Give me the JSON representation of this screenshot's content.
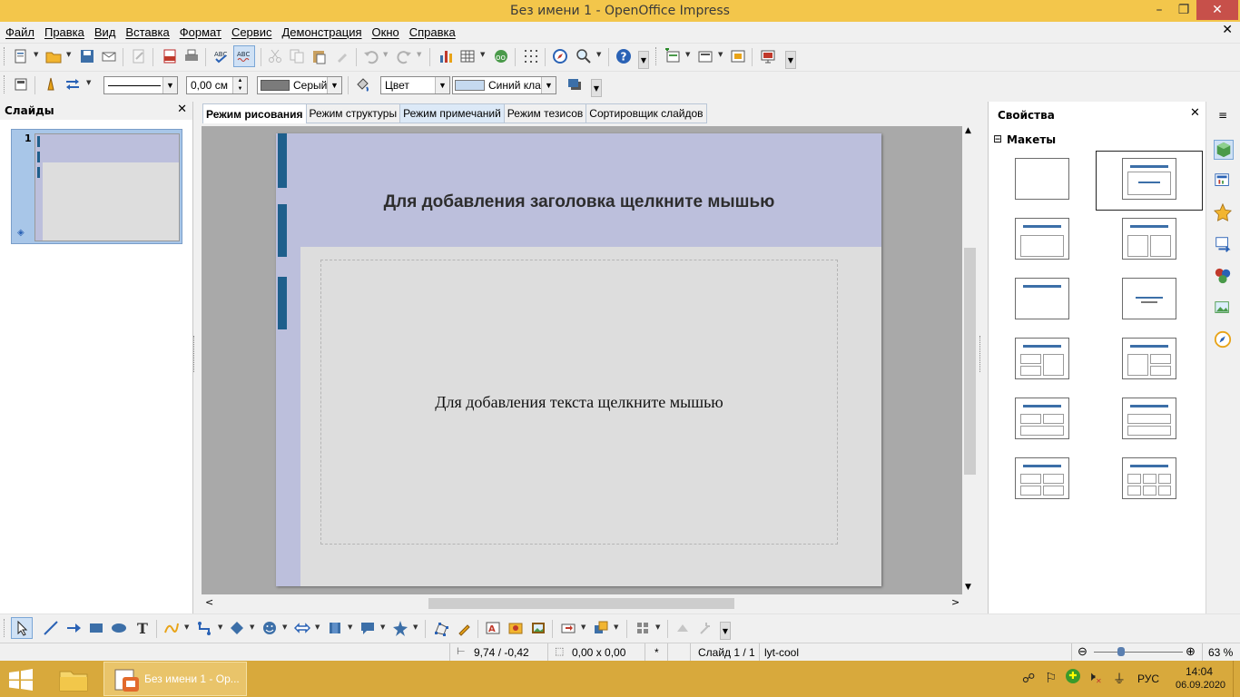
{
  "window": {
    "title": "Без имени 1 - OpenOffice Impress",
    "minimize": "–",
    "restore": "❐",
    "close": "✕",
    "doc_close": "✕"
  },
  "menu": [
    "Файл",
    "Правка",
    "Вид",
    "Вставка",
    "Формат",
    "Сервис",
    "Демонстрация",
    "Окно",
    "Справка"
  ],
  "line_toolbar": {
    "line_width": "0,00 см",
    "line_color": "Серый",
    "area_style": "Цвет",
    "area_color": "Синий кла"
  },
  "slides_panel": {
    "title": "Слайды",
    "close": "✕",
    "slide_number": "1"
  },
  "view_tabs": [
    "Режим рисования",
    "Режим структуры",
    "Режим примечаний",
    "Режим тезисов",
    "Сортировщик слайдов"
  ],
  "slide": {
    "title_placeholder": "Для добавления заголовка щелкните мышью",
    "body_placeholder": "Для добавления текста щелкните мышью"
  },
  "properties_panel": {
    "title": "Свойства",
    "close": "✕",
    "section": "Макеты",
    "section_toggle": "⊟",
    "menu": "≡"
  },
  "status": {
    "position": "9,74 / -0,42",
    "size": "0,00 x 0,00",
    "modified": "*",
    "slide": "Слайд 1 / 1",
    "master": "lyt-cool",
    "zoom": "63 %"
  },
  "taskbar": {
    "app_label": "Без имени 1 - Ор...",
    "language": "РУС",
    "time": "14:04",
    "date": "06.09.2020"
  },
  "colors": {
    "title_bar": "#f3c64b",
    "taskbar": "#d8a93c",
    "slide_accent": "#1e5f8c",
    "slide_band": "#bcbfdc"
  }
}
